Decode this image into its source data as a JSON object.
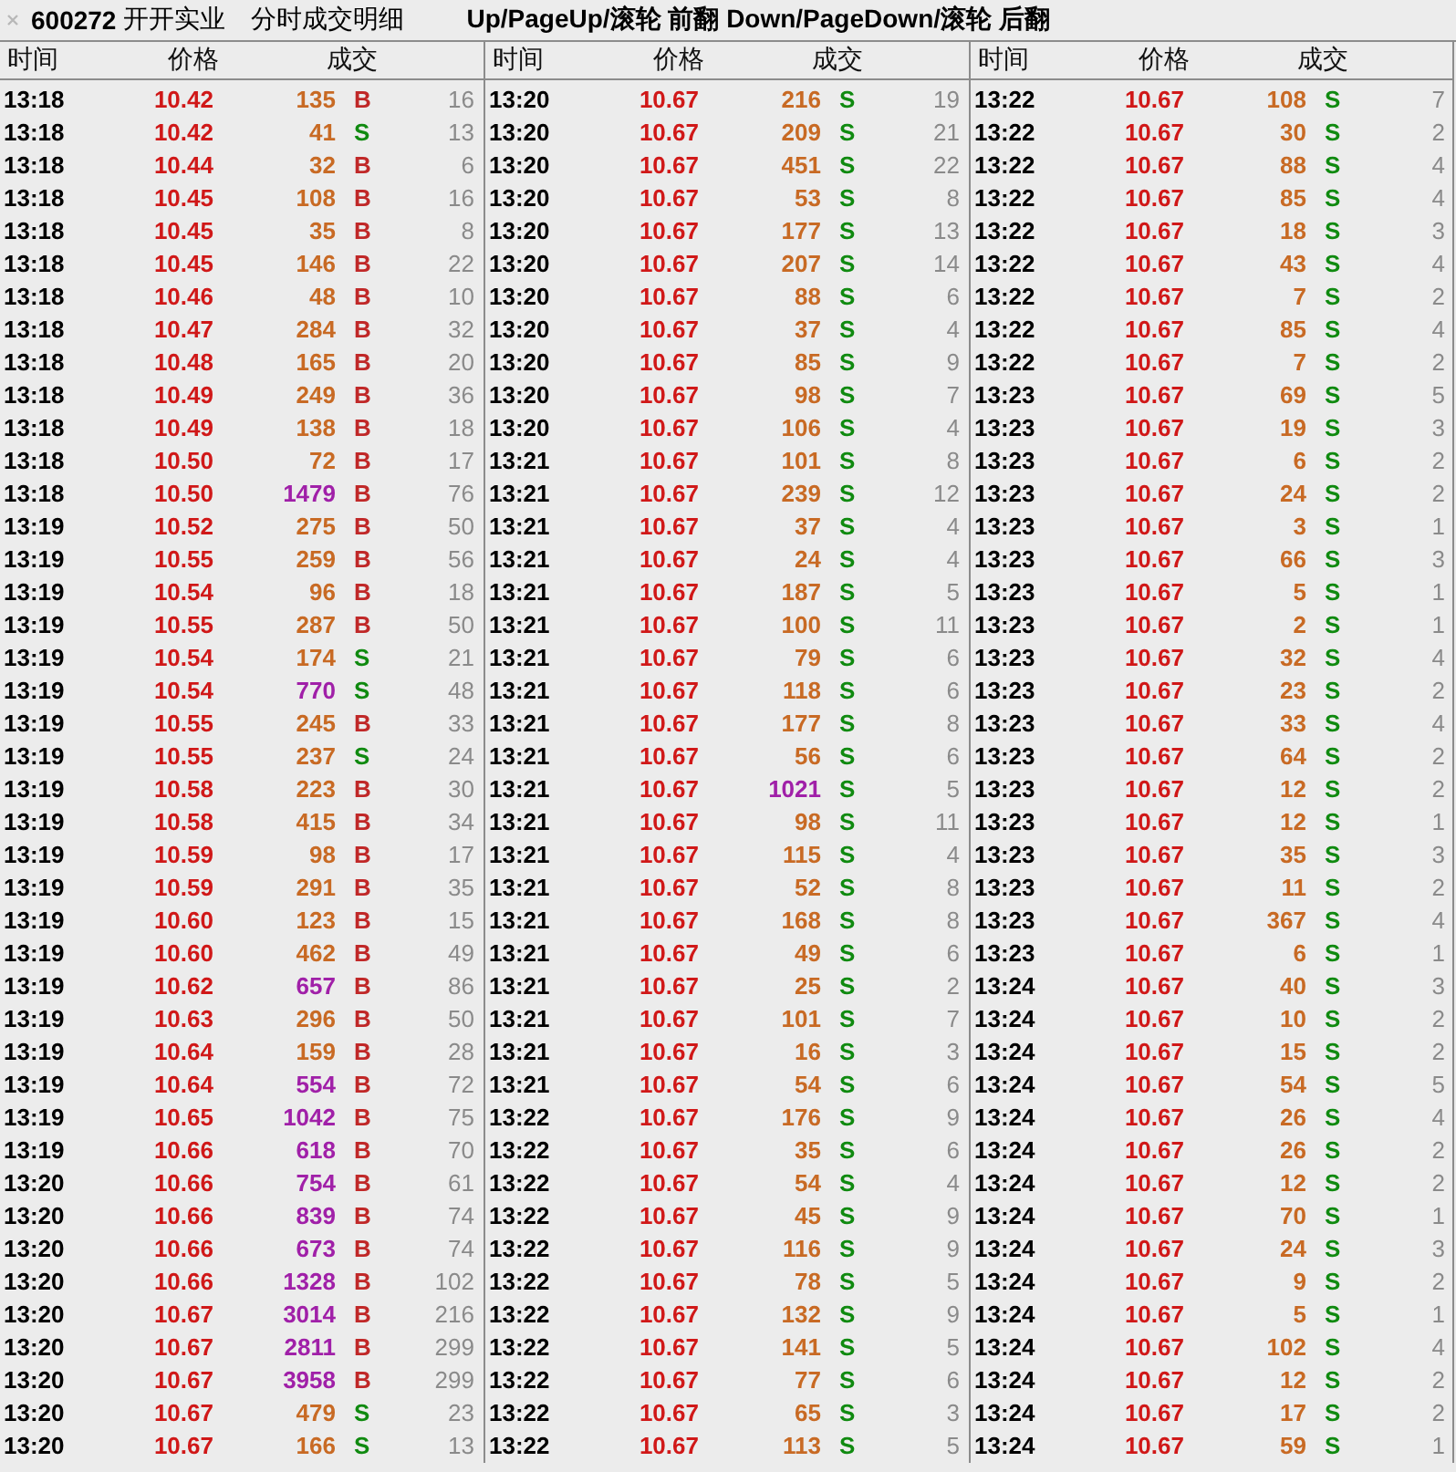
{
  "title": {
    "code": "600272",
    "name": "开开实业",
    "caption": "分时成交明细",
    "hint": "Up/PageUp/滚轮 前翻 Down/PageDown/滚轮 后翻"
  },
  "panels": [
    {
      "headers": [
        "时间",
        "价格",
        "成交"
      ],
      "rows": [
        {
          "time": "13:18",
          "price": "10.42",
          "volume": "135",
          "large": false,
          "side": "B",
          "buy": true,
          "count": "16"
        },
        {
          "time": "13:18",
          "price": "10.42",
          "volume": "41",
          "large": false,
          "side": "S",
          "buy": false,
          "count": "13"
        },
        {
          "time": "13:18",
          "price": "10.44",
          "volume": "32",
          "large": false,
          "side": "B",
          "buy": true,
          "count": "6"
        },
        {
          "time": "13:18",
          "price": "10.45",
          "volume": "108",
          "large": false,
          "side": "B",
          "buy": true,
          "count": "16"
        },
        {
          "time": "13:18",
          "price": "10.45",
          "volume": "35",
          "large": false,
          "side": "B",
          "buy": true,
          "count": "8"
        },
        {
          "time": "13:18",
          "price": "10.45",
          "volume": "146",
          "large": false,
          "side": "B",
          "buy": true,
          "count": "22"
        },
        {
          "time": "13:18",
          "price": "10.46",
          "volume": "48",
          "large": false,
          "side": "B",
          "buy": true,
          "count": "10"
        },
        {
          "time": "13:18",
          "price": "10.47",
          "volume": "284",
          "large": false,
          "side": "B",
          "buy": true,
          "count": "32"
        },
        {
          "time": "13:18",
          "price": "10.48",
          "volume": "165",
          "large": false,
          "side": "B",
          "buy": true,
          "count": "20"
        },
        {
          "time": "13:18",
          "price": "10.49",
          "volume": "249",
          "large": false,
          "side": "B",
          "buy": true,
          "count": "36"
        },
        {
          "time": "13:18",
          "price": "10.49",
          "volume": "138",
          "large": false,
          "side": "B",
          "buy": true,
          "count": "18"
        },
        {
          "time": "13:18",
          "price": "10.50",
          "volume": "72",
          "large": false,
          "side": "B",
          "buy": true,
          "count": "17"
        },
        {
          "time": "13:18",
          "price": "10.50",
          "volume": "1479",
          "large": true,
          "side": "B",
          "buy": true,
          "count": "76"
        },
        {
          "time": "13:19",
          "price": "10.52",
          "volume": "275",
          "large": false,
          "side": "B",
          "buy": true,
          "count": "50"
        },
        {
          "time": "13:19",
          "price": "10.55",
          "volume": "259",
          "large": false,
          "side": "B",
          "buy": true,
          "count": "56"
        },
        {
          "time": "13:19",
          "price": "10.54",
          "volume": "96",
          "large": false,
          "side": "B",
          "buy": true,
          "count": "18"
        },
        {
          "time": "13:19",
          "price": "10.55",
          "volume": "287",
          "large": false,
          "side": "B",
          "buy": true,
          "count": "50"
        },
        {
          "time": "13:19",
          "price": "10.54",
          "volume": "174",
          "large": false,
          "side": "S",
          "buy": false,
          "count": "21"
        },
        {
          "time": "13:19",
          "price": "10.54",
          "volume": "770",
          "large": true,
          "side": "S",
          "buy": false,
          "count": "48"
        },
        {
          "time": "13:19",
          "price": "10.55",
          "volume": "245",
          "large": false,
          "side": "B",
          "buy": true,
          "count": "33"
        },
        {
          "time": "13:19",
          "price": "10.55",
          "volume": "237",
          "large": false,
          "side": "S",
          "buy": false,
          "count": "24"
        },
        {
          "time": "13:19",
          "price": "10.58",
          "volume": "223",
          "large": false,
          "side": "B",
          "buy": true,
          "count": "30"
        },
        {
          "time": "13:19",
          "price": "10.58",
          "volume": "415",
          "large": false,
          "side": "B",
          "buy": true,
          "count": "34"
        },
        {
          "time": "13:19",
          "price": "10.59",
          "volume": "98",
          "large": false,
          "side": "B",
          "buy": true,
          "count": "17"
        },
        {
          "time": "13:19",
          "price": "10.59",
          "volume": "291",
          "large": false,
          "side": "B",
          "buy": true,
          "count": "35"
        },
        {
          "time": "13:19",
          "price": "10.60",
          "volume": "123",
          "large": false,
          "side": "B",
          "buy": true,
          "count": "15"
        },
        {
          "time": "13:19",
          "price": "10.60",
          "volume": "462",
          "large": false,
          "side": "B",
          "buy": true,
          "count": "49"
        },
        {
          "time": "13:19",
          "price": "10.62",
          "volume": "657",
          "large": true,
          "side": "B",
          "buy": true,
          "count": "86"
        },
        {
          "time": "13:19",
          "price": "10.63",
          "volume": "296",
          "large": false,
          "side": "B",
          "buy": true,
          "count": "50"
        },
        {
          "time": "13:19",
          "price": "10.64",
          "volume": "159",
          "large": false,
          "side": "B",
          "buy": true,
          "count": "28"
        },
        {
          "time": "13:19",
          "price": "10.64",
          "volume": "554",
          "large": true,
          "side": "B",
          "buy": true,
          "count": "72"
        },
        {
          "time": "13:19",
          "price": "10.65",
          "volume": "1042",
          "large": true,
          "side": "B",
          "buy": true,
          "count": "75"
        },
        {
          "time": "13:19",
          "price": "10.66",
          "volume": "618",
          "large": true,
          "side": "B",
          "buy": true,
          "count": "70"
        },
        {
          "time": "13:20",
          "price": "10.66",
          "volume": "754",
          "large": true,
          "side": "B",
          "buy": true,
          "count": "61"
        },
        {
          "time": "13:20",
          "price": "10.66",
          "volume": "839",
          "large": true,
          "side": "B",
          "buy": true,
          "count": "74"
        },
        {
          "time": "13:20",
          "price": "10.66",
          "volume": "673",
          "large": true,
          "side": "B",
          "buy": true,
          "count": "74"
        },
        {
          "time": "13:20",
          "price": "10.66",
          "volume": "1328",
          "large": true,
          "side": "B",
          "buy": true,
          "count": "102"
        },
        {
          "time": "13:20",
          "price": "10.67",
          "volume": "3014",
          "large": true,
          "side": "B",
          "buy": true,
          "count": "216"
        },
        {
          "time": "13:20",
          "price": "10.67",
          "volume": "2811",
          "large": true,
          "side": "B",
          "buy": true,
          "count": "299"
        },
        {
          "time": "13:20",
          "price": "10.67",
          "volume": "3958",
          "large": true,
          "side": "B",
          "buy": true,
          "count": "299"
        },
        {
          "time": "13:20",
          "price": "10.67",
          "volume": "479",
          "large": false,
          "side": "S",
          "buy": false,
          "count": "23"
        },
        {
          "time": "13:20",
          "price": "10.67",
          "volume": "166",
          "large": false,
          "side": "S",
          "buy": false,
          "count": "13"
        }
      ]
    },
    {
      "headers": [
        "时间",
        "价格",
        "成交"
      ],
      "rows": [
        {
          "time": "13:20",
          "price": "10.67",
          "volume": "216",
          "large": false,
          "side": "S",
          "buy": false,
          "count": "19"
        },
        {
          "time": "13:20",
          "price": "10.67",
          "volume": "209",
          "large": false,
          "side": "S",
          "buy": false,
          "count": "21"
        },
        {
          "time": "13:20",
          "price": "10.67",
          "volume": "451",
          "large": false,
          "side": "S",
          "buy": false,
          "count": "22"
        },
        {
          "time": "13:20",
          "price": "10.67",
          "volume": "53",
          "large": false,
          "side": "S",
          "buy": false,
          "count": "8"
        },
        {
          "time": "13:20",
          "price": "10.67",
          "volume": "177",
          "large": false,
          "side": "S",
          "buy": false,
          "count": "13"
        },
        {
          "time": "13:20",
          "price": "10.67",
          "volume": "207",
          "large": false,
          "side": "S",
          "buy": false,
          "count": "14"
        },
        {
          "time": "13:20",
          "price": "10.67",
          "volume": "88",
          "large": false,
          "side": "S",
          "buy": false,
          "count": "6"
        },
        {
          "time": "13:20",
          "price": "10.67",
          "volume": "37",
          "large": false,
          "side": "S",
          "buy": false,
          "count": "4"
        },
        {
          "time": "13:20",
          "price": "10.67",
          "volume": "85",
          "large": false,
          "side": "S",
          "buy": false,
          "count": "9"
        },
        {
          "time": "13:20",
          "price": "10.67",
          "volume": "98",
          "large": false,
          "side": "S",
          "buy": false,
          "count": "7"
        },
        {
          "time": "13:20",
          "price": "10.67",
          "volume": "106",
          "large": false,
          "side": "S",
          "buy": false,
          "count": "4"
        },
        {
          "time": "13:21",
          "price": "10.67",
          "volume": "101",
          "large": false,
          "side": "S",
          "buy": false,
          "count": "8"
        },
        {
          "time": "13:21",
          "price": "10.67",
          "volume": "239",
          "large": false,
          "side": "S",
          "buy": false,
          "count": "12"
        },
        {
          "time": "13:21",
          "price": "10.67",
          "volume": "37",
          "large": false,
          "side": "S",
          "buy": false,
          "count": "4"
        },
        {
          "time": "13:21",
          "price": "10.67",
          "volume": "24",
          "large": false,
          "side": "S",
          "buy": false,
          "count": "4"
        },
        {
          "time": "13:21",
          "price": "10.67",
          "volume": "187",
          "large": false,
          "side": "S",
          "buy": false,
          "count": "5"
        },
        {
          "time": "13:21",
          "price": "10.67",
          "volume": "100",
          "large": false,
          "side": "S",
          "buy": false,
          "count": "11"
        },
        {
          "time": "13:21",
          "price": "10.67",
          "volume": "79",
          "large": false,
          "side": "S",
          "buy": false,
          "count": "6"
        },
        {
          "time": "13:21",
          "price": "10.67",
          "volume": "118",
          "large": false,
          "side": "S",
          "buy": false,
          "count": "6"
        },
        {
          "time": "13:21",
          "price": "10.67",
          "volume": "177",
          "large": false,
          "side": "S",
          "buy": false,
          "count": "8"
        },
        {
          "time": "13:21",
          "price": "10.67",
          "volume": "56",
          "large": false,
          "side": "S",
          "buy": false,
          "count": "6"
        },
        {
          "time": "13:21",
          "price": "10.67",
          "volume": "1021",
          "large": true,
          "side": "S",
          "buy": false,
          "count": "5"
        },
        {
          "time": "13:21",
          "price": "10.67",
          "volume": "98",
          "large": false,
          "side": "S",
          "buy": false,
          "count": "11"
        },
        {
          "time": "13:21",
          "price": "10.67",
          "volume": "115",
          "large": false,
          "side": "S",
          "buy": false,
          "count": "4"
        },
        {
          "time": "13:21",
          "price": "10.67",
          "volume": "52",
          "large": false,
          "side": "S",
          "buy": false,
          "count": "8"
        },
        {
          "time": "13:21",
          "price": "10.67",
          "volume": "168",
          "large": false,
          "side": "S",
          "buy": false,
          "count": "8"
        },
        {
          "time": "13:21",
          "price": "10.67",
          "volume": "49",
          "large": false,
          "side": "S",
          "buy": false,
          "count": "6"
        },
        {
          "time": "13:21",
          "price": "10.67",
          "volume": "25",
          "large": false,
          "side": "S",
          "buy": false,
          "count": "2"
        },
        {
          "time": "13:21",
          "price": "10.67",
          "volume": "101",
          "large": false,
          "side": "S",
          "buy": false,
          "count": "7"
        },
        {
          "time": "13:21",
          "price": "10.67",
          "volume": "16",
          "large": false,
          "side": "S",
          "buy": false,
          "count": "3"
        },
        {
          "time": "13:21",
          "price": "10.67",
          "volume": "54",
          "large": false,
          "side": "S",
          "buy": false,
          "count": "6"
        },
        {
          "time": "13:22",
          "price": "10.67",
          "volume": "176",
          "large": false,
          "side": "S",
          "buy": false,
          "count": "9"
        },
        {
          "time": "13:22",
          "price": "10.67",
          "volume": "35",
          "large": false,
          "side": "S",
          "buy": false,
          "count": "6"
        },
        {
          "time": "13:22",
          "price": "10.67",
          "volume": "54",
          "large": false,
          "side": "S",
          "buy": false,
          "count": "4"
        },
        {
          "time": "13:22",
          "price": "10.67",
          "volume": "45",
          "large": false,
          "side": "S",
          "buy": false,
          "count": "9"
        },
        {
          "time": "13:22",
          "price": "10.67",
          "volume": "116",
          "large": false,
          "side": "S",
          "buy": false,
          "count": "9"
        },
        {
          "time": "13:22",
          "price": "10.67",
          "volume": "78",
          "large": false,
          "side": "S",
          "buy": false,
          "count": "5"
        },
        {
          "time": "13:22",
          "price": "10.67",
          "volume": "132",
          "large": false,
          "side": "S",
          "buy": false,
          "count": "9"
        },
        {
          "time": "13:22",
          "price": "10.67",
          "volume": "141",
          "large": false,
          "side": "S",
          "buy": false,
          "count": "5"
        },
        {
          "time": "13:22",
          "price": "10.67",
          "volume": "77",
          "large": false,
          "side": "S",
          "buy": false,
          "count": "6"
        },
        {
          "time": "13:22",
          "price": "10.67",
          "volume": "65",
          "large": false,
          "side": "S",
          "buy": false,
          "count": "3"
        },
        {
          "time": "13:22",
          "price": "10.67",
          "volume": "113",
          "large": false,
          "side": "S",
          "buy": false,
          "count": "5"
        }
      ]
    },
    {
      "headers": [
        "时间",
        "价格",
        "成交"
      ],
      "rows": [
        {
          "time": "13:22",
          "price": "10.67",
          "volume": "108",
          "large": false,
          "side": "S",
          "buy": false,
          "count": "7"
        },
        {
          "time": "13:22",
          "price": "10.67",
          "volume": "30",
          "large": false,
          "side": "S",
          "buy": false,
          "count": "2"
        },
        {
          "time": "13:22",
          "price": "10.67",
          "volume": "88",
          "large": false,
          "side": "S",
          "buy": false,
          "count": "4"
        },
        {
          "time": "13:22",
          "price": "10.67",
          "volume": "85",
          "large": false,
          "side": "S",
          "buy": false,
          "count": "4"
        },
        {
          "time": "13:22",
          "price": "10.67",
          "volume": "18",
          "large": false,
          "side": "S",
          "buy": false,
          "count": "3"
        },
        {
          "time": "13:22",
          "price": "10.67",
          "volume": "43",
          "large": false,
          "side": "S",
          "buy": false,
          "count": "4"
        },
        {
          "time": "13:22",
          "price": "10.67",
          "volume": "7",
          "large": false,
          "side": "S",
          "buy": false,
          "count": "2"
        },
        {
          "time": "13:22",
          "price": "10.67",
          "volume": "85",
          "large": false,
          "side": "S",
          "buy": false,
          "count": "4"
        },
        {
          "time": "13:22",
          "price": "10.67",
          "volume": "7",
          "large": false,
          "side": "S",
          "buy": false,
          "count": "2"
        },
        {
          "time": "13:23",
          "price": "10.67",
          "volume": "69",
          "large": false,
          "side": "S",
          "buy": false,
          "count": "5"
        },
        {
          "time": "13:23",
          "price": "10.67",
          "volume": "19",
          "large": false,
          "side": "S",
          "buy": false,
          "count": "3"
        },
        {
          "time": "13:23",
          "price": "10.67",
          "volume": "6",
          "large": false,
          "side": "S",
          "buy": false,
          "count": "2"
        },
        {
          "time": "13:23",
          "price": "10.67",
          "volume": "24",
          "large": false,
          "side": "S",
          "buy": false,
          "count": "2"
        },
        {
          "time": "13:23",
          "price": "10.67",
          "volume": "3",
          "large": false,
          "side": "S",
          "buy": false,
          "count": "1"
        },
        {
          "time": "13:23",
          "price": "10.67",
          "volume": "66",
          "large": false,
          "side": "S",
          "buy": false,
          "count": "3"
        },
        {
          "time": "13:23",
          "price": "10.67",
          "volume": "5",
          "large": false,
          "side": "S",
          "buy": false,
          "count": "1"
        },
        {
          "time": "13:23",
          "price": "10.67",
          "volume": "2",
          "large": false,
          "side": "S",
          "buy": false,
          "count": "1"
        },
        {
          "time": "13:23",
          "price": "10.67",
          "volume": "32",
          "large": false,
          "side": "S",
          "buy": false,
          "count": "4"
        },
        {
          "time": "13:23",
          "price": "10.67",
          "volume": "23",
          "large": false,
          "side": "S",
          "buy": false,
          "count": "2"
        },
        {
          "time": "13:23",
          "price": "10.67",
          "volume": "33",
          "large": false,
          "side": "S",
          "buy": false,
          "count": "4"
        },
        {
          "time": "13:23",
          "price": "10.67",
          "volume": "64",
          "large": false,
          "side": "S",
          "buy": false,
          "count": "2"
        },
        {
          "time": "13:23",
          "price": "10.67",
          "volume": "12",
          "large": false,
          "side": "S",
          "buy": false,
          "count": "2"
        },
        {
          "time": "13:23",
          "price": "10.67",
          "volume": "12",
          "large": false,
          "side": "S",
          "buy": false,
          "count": "1"
        },
        {
          "time": "13:23",
          "price": "10.67",
          "volume": "35",
          "large": false,
          "side": "S",
          "buy": false,
          "count": "3"
        },
        {
          "time": "13:23",
          "price": "10.67",
          "volume": "11",
          "large": false,
          "side": "S",
          "buy": false,
          "count": "2"
        },
        {
          "time": "13:23",
          "price": "10.67",
          "volume": "367",
          "large": false,
          "side": "S",
          "buy": false,
          "count": "4"
        },
        {
          "time": "13:23",
          "price": "10.67",
          "volume": "6",
          "large": false,
          "side": "S",
          "buy": false,
          "count": "1"
        },
        {
          "time": "13:24",
          "price": "10.67",
          "volume": "40",
          "large": false,
          "side": "S",
          "buy": false,
          "count": "3"
        },
        {
          "time": "13:24",
          "price": "10.67",
          "volume": "10",
          "large": false,
          "side": "S",
          "buy": false,
          "count": "2"
        },
        {
          "time": "13:24",
          "price": "10.67",
          "volume": "15",
          "large": false,
          "side": "S",
          "buy": false,
          "count": "2"
        },
        {
          "time": "13:24",
          "price": "10.67",
          "volume": "54",
          "large": false,
          "side": "S",
          "buy": false,
          "count": "5"
        },
        {
          "time": "13:24",
          "price": "10.67",
          "volume": "26",
          "large": false,
          "side": "S",
          "buy": false,
          "count": "4"
        },
        {
          "time": "13:24",
          "price": "10.67",
          "volume": "26",
          "large": false,
          "side": "S",
          "buy": false,
          "count": "2"
        },
        {
          "time": "13:24",
          "price": "10.67",
          "volume": "12",
          "large": false,
          "side": "S",
          "buy": false,
          "count": "2"
        },
        {
          "time": "13:24",
          "price": "10.67",
          "volume": "70",
          "large": false,
          "side": "S",
          "buy": false,
          "count": "1"
        },
        {
          "time": "13:24",
          "price": "10.67",
          "volume": "24",
          "large": false,
          "side": "S",
          "buy": false,
          "count": "3"
        },
        {
          "time": "13:24",
          "price": "10.67",
          "volume": "9",
          "large": false,
          "side": "S",
          "buy": false,
          "count": "2"
        },
        {
          "time": "13:24",
          "price": "10.67",
          "volume": "5",
          "large": false,
          "side": "S",
          "buy": false,
          "count": "1"
        },
        {
          "time": "13:24",
          "price": "10.67",
          "volume": "102",
          "large": false,
          "side": "S",
          "buy": false,
          "count": "4"
        },
        {
          "time": "13:24",
          "price": "10.67",
          "volume": "12",
          "large": false,
          "side": "S",
          "buy": false,
          "count": "2"
        },
        {
          "time": "13:24",
          "price": "10.67",
          "volume": "17",
          "large": false,
          "side": "S",
          "buy": false,
          "count": "2"
        },
        {
          "time": "13:24",
          "price": "10.67",
          "volume": "59",
          "large": false,
          "side": "S",
          "buy": false,
          "count": "1"
        }
      ]
    }
  ]
}
